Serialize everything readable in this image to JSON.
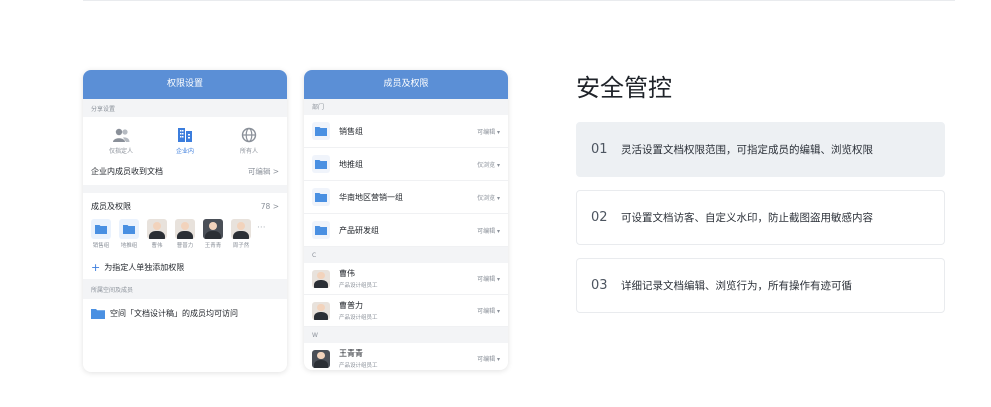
{
  "phone1": {
    "header": "权限设置",
    "share_label": "分享设置",
    "share_options": [
      {
        "label": "仅指定人",
        "icon": "people-icon",
        "active": false
      },
      {
        "label": "企业内",
        "icon": "building-icon",
        "active": true
      },
      {
        "label": "所有人",
        "icon": "globe-icon",
        "active": false
      }
    ],
    "receive_label": "企业内成员收到文档",
    "receive_value": "可编辑 >",
    "members_label": "成员及权限",
    "members_count": "78 >",
    "avatars": [
      {
        "name": "销售组",
        "type": "folder"
      },
      {
        "name": "地推组",
        "type": "folder"
      },
      {
        "name": "曹伟",
        "type": "person"
      },
      {
        "name": "曹普力",
        "type": "person"
      },
      {
        "name": "王青青",
        "type": "person"
      },
      {
        "name": "周子然",
        "type": "person"
      }
    ],
    "more": "···",
    "add_plus": "+",
    "add_label": "为指定人单独添加权限",
    "space_label": "所属空间及成员",
    "space_text": "空间「文档设计稿」的成员均可访问"
  },
  "phone2": {
    "header": "成员及权限",
    "dept_label": "部门",
    "departments": [
      {
        "name": "销售组",
        "perm": "可编辑 ▾"
      },
      {
        "name": "地推组",
        "perm": "仅浏览 ▾"
      },
      {
        "name": "华南地区营销一组",
        "perm": "仅浏览 ▾"
      },
      {
        "name": "产品研发组",
        "perm": "可编辑 ▾"
      }
    ],
    "section_c": "C",
    "people_c": [
      {
        "name": "曹伟",
        "role": "产品设计组员工",
        "perm": "可编辑 ▾"
      },
      {
        "name": "曹普力",
        "role": "产品设计组员工",
        "perm": "可编辑 ▾"
      }
    ],
    "section_w": "W",
    "people_w": [
      {
        "name": "王青青",
        "role": "产品设计组员工",
        "perm": "可编辑 ▾"
      }
    ]
  },
  "section": {
    "title": "安全管控",
    "features": [
      {
        "num": "01",
        "text": "灵活设置文档权限范围，可指定成员的编辑、浏览权限"
      },
      {
        "num": "02",
        "text": "可设置文档访客、自定义水印，防止截图盗用敏感内容"
      },
      {
        "num": "03",
        "text": "详细记录文档编辑、浏览行为，所有操作有迹可循"
      }
    ]
  },
  "colors": {
    "accent": "#3b7ddd",
    "header": "#5b8fd6",
    "folder": "#4a90e2"
  }
}
